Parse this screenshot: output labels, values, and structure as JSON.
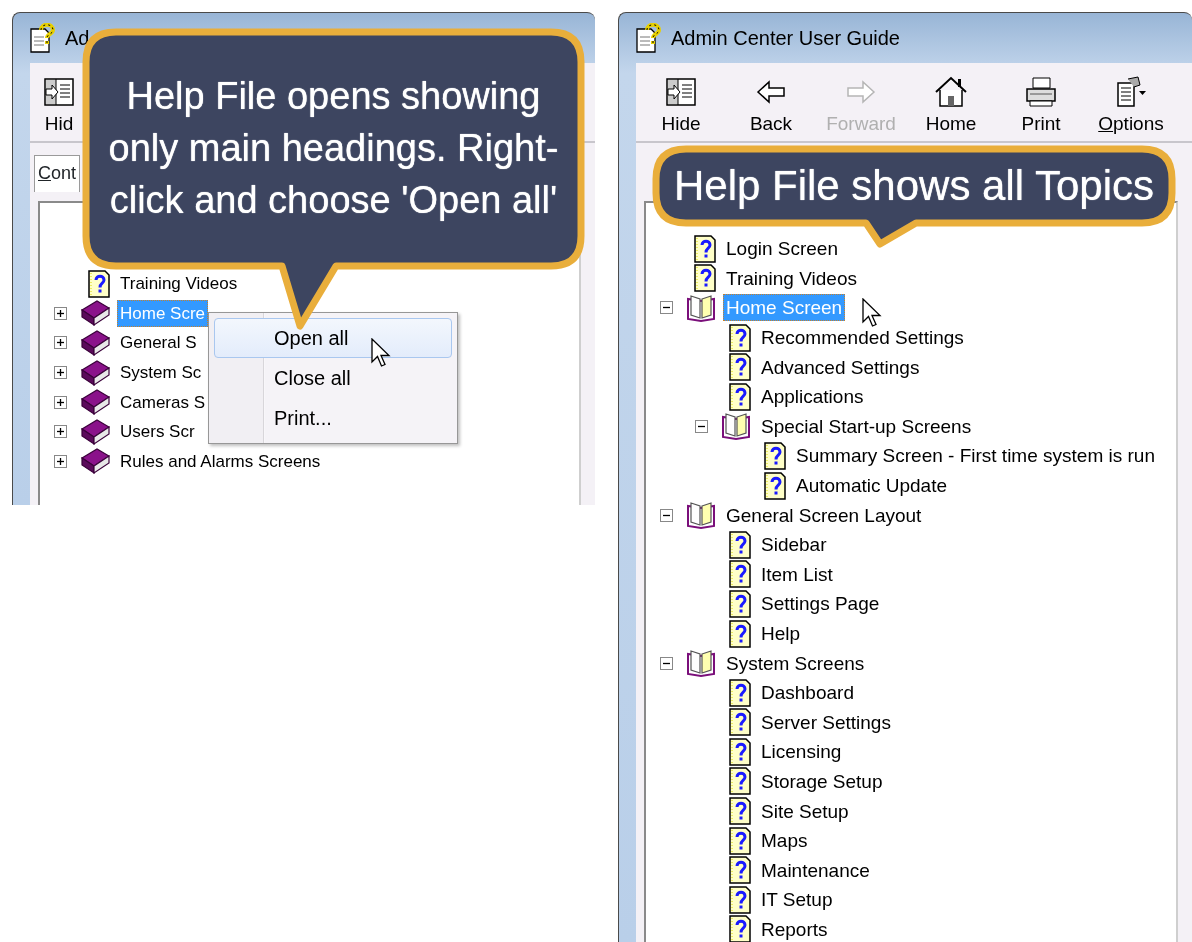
{
  "left_window": {
    "title": "Ad",
    "toolbar": [
      {
        "kind": "hide",
        "label": "Hid",
        "disabled": false,
        "underline_first": false
      }
    ],
    "tab": {
      "label": "Cont",
      "underline_first": true
    },
    "tree": [
      {
        "kind": "page",
        "label": "Training Videos",
        "selected": false
      },
      {
        "kind": "book",
        "label": "Home Scre",
        "expanded": false,
        "selected": true
      },
      {
        "kind": "book",
        "label": "General S",
        "expanded": false,
        "selected": false
      },
      {
        "kind": "book",
        "label": "System Sc",
        "expanded": false,
        "selected": false
      },
      {
        "kind": "book",
        "label": "Cameras S",
        "expanded": false,
        "selected": false
      },
      {
        "kind": "book",
        "label": "Users Scr",
        "expanded": false,
        "selected": false
      },
      {
        "kind": "book",
        "label": "Rules and Alarms Screens",
        "expanded": false,
        "selected": false
      }
    ],
    "context_menu": [
      {
        "label": "Open all",
        "selected": true
      },
      {
        "label": "Close all",
        "selected": false
      },
      {
        "label": "Print...",
        "selected": false
      }
    ]
  },
  "left_callout": {
    "text": "Help File opens showing only main headings. Right-click and choose 'Open all'"
  },
  "right_window": {
    "title": "Admin Center User Guide",
    "toolbar": [
      {
        "kind": "hide",
        "label": "Hide",
        "disabled": false,
        "underline_first": false
      },
      {
        "kind": "back",
        "label": "Back",
        "disabled": false,
        "underline_first": false
      },
      {
        "kind": "forward",
        "label": "Forward",
        "disabled": true,
        "underline_first": false
      },
      {
        "kind": "home",
        "label": "Home",
        "disabled": false,
        "underline_first": false
      },
      {
        "kind": "print",
        "label": "Print",
        "disabled": false,
        "underline_first": false
      },
      {
        "kind": "options",
        "label": "Options",
        "disabled": false,
        "underline_first": true
      }
    ],
    "tree": [
      {
        "kind": "page",
        "label": "Login Screen",
        "selected": false
      },
      {
        "kind": "page",
        "label": "Training Videos",
        "selected": false
      },
      {
        "kind": "book",
        "label": "Home Screen",
        "expanded": true,
        "selected": true,
        "children": [
          {
            "kind": "page",
            "label": "Recommended Settings",
            "selected": false
          },
          {
            "kind": "page",
            "label": "Advanced Settings",
            "selected": false
          },
          {
            "kind": "page",
            "label": "Applications",
            "selected": false
          },
          {
            "kind": "book",
            "label": "Special Start-up Screens",
            "expanded": true,
            "selected": false,
            "children": [
              {
                "kind": "page",
                "label": "Summary Screen - First time system is run",
                "selected": false
              },
              {
                "kind": "page",
                "label": "Automatic Update",
                "selected": false
              }
            ]
          }
        ]
      },
      {
        "kind": "book",
        "label": "General Screen Layout",
        "expanded": true,
        "selected": false,
        "children": [
          {
            "kind": "page",
            "label": "Sidebar",
            "selected": false
          },
          {
            "kind": "page",
            "label": "Item List",
            "selected": false
          },
          {
            "kind": "page",
            "label": "Settings Page",
            "selected": false
          },
          {
            "kind": "page",
            "label": "Help",
            "selected": false
          }
        ]
      },
      {
        "kind": "book",
        "label": "System Screens",
        "expanded": true,
        "selected": false,
        "children": [
          {
            "kind": "page",
            "label": "Dashboard",
            "selected": false
          },
          {
            "kind": "page",
            "label": "Server Settings",
            "selected": false
          },
          {
            "kind": "page",
            "label": "Licensing",
            "selected": false
          },
          {
            "kind": "page",
            "label": "Storage Setup",
            "selected": false
          },
          {
            "kind": "page",
            "label": "Site Setup",
            "selected": false
          },
          {
            "kind": "page",
            "label": "Maps",
            "selected": false
          },
          {
            "kind": "page",
            "label": "Maintenance",
            "selected": false
          },
          {
            "kind": "page",
            "label": "IT Setup",
            "selected": false
          },
          {
            "kind": "page",
            "label": "Reports",
            "selected": false
          }
        ]
      }
    ]
  },
  "right_callout": {
    "text": "Help File shows all Topics"
  }
}
